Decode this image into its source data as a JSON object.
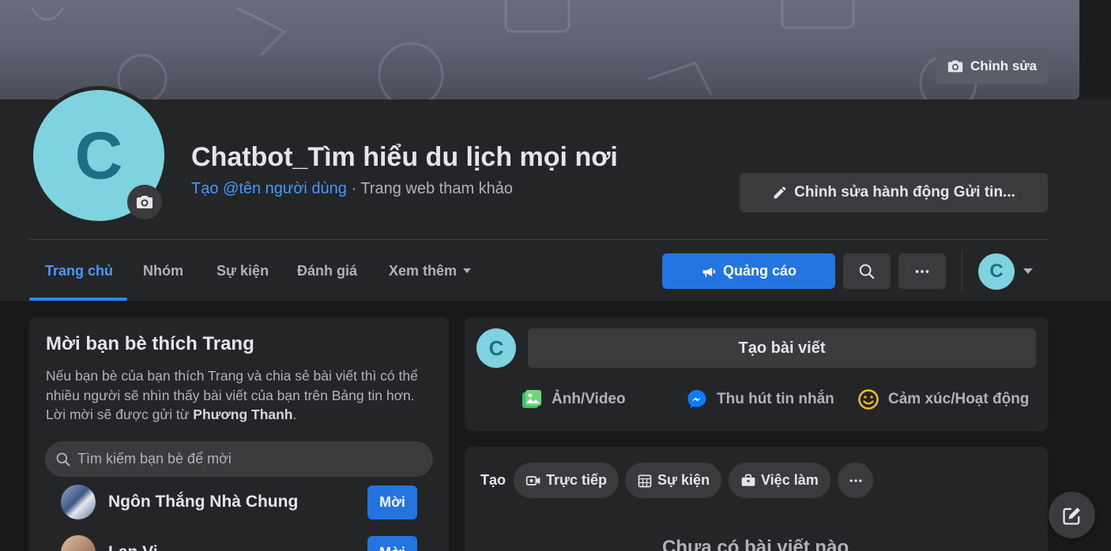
{
  "cover": {
    "edit_label": "Chỉnh sửa"
  },
  "profile": {
    "avatar_letter": "C",
    "name": "Chatbot_Tìm hiểu du lịch mọi nơi",
    "username_link": "Tạo @tên người dùng",
    "category": " · Trang web tham khảo",
    "edit_action_label": "Chỉnh sửa hành động Gửi tin..."
  },
  "tabs": [
    {
      "label": "Trang chủ",
      "active": true
    },
    {
      "label": "Nhóm"
    },
    {
      "label": "Sự kiện"
    },
    {
      "label": "Đánh giá"
    },
    {
      "label": "Xem thêm"
    }
  ],
  "toolbar": {
    "ads_label": "Quảng cáo",
    "search_icon": "search-icon",
    "more_icon": "more-icon",
    "account_letter": "C"
  },
  "invite": {
    "title": "Mời bạn bè thích Trang",
    "desc_prefix": "Nếu bạn bè của bạn thích Trang và chia sẻ bài viết thì có thể nhiều người sẽ nhìn thấy bài viết của bạn trên Bảng tin hơn. Lời mời sẽ được gửi từ ",
    "desc_sender": "Phương Thanh",
    "desc_suffix": ".",
    "search_placeholder": "Tìm kiếm bạn bè để mời",
    "friends": [
      {
        "name": "Ngôn Thắng Nhà Chung",
        "button": "Mời"
      },
      {
        "name": "Lan Vi",
        "button": "Mời"
      }
    ]
  },
  "composer": {
    "avatar_letter": "C",
    "prompt": "Tạo bài viết",
    "actions": [
      {
        "label": "Ảnh/Video",
        "icon": "photo-icon"
      },
      {
        "label": "Thu hút tin nhắn",
        "icon": "messenger-icon"
      },
      {
        "label": "Cảm xúc/Hoạt động",
        "icon": "smile-icon"
      }
    ]
  },
  "create": {
    "label": "Tạo",
    "pills": [
      {
        "label": "Trực tiếp",
        "icon": "live-video-icon"
      },
      {
        "label": "Sự kiện",
        "icon": "calendar-icon"
      },
      {
        "label": "Việc làm",
        "icon": "briefcase-icon"
      }
    ]
  },
  "feed": {
    "empty_text": "Chưa có bài viết nào"
  },
  "colors": {
    "accent": "#2374e1",
    "link": "#4599ff",
    "avatar_bg": "#7fd3e0",
    "surface": "#242526",
    "background": "#18191a"
  }
}
